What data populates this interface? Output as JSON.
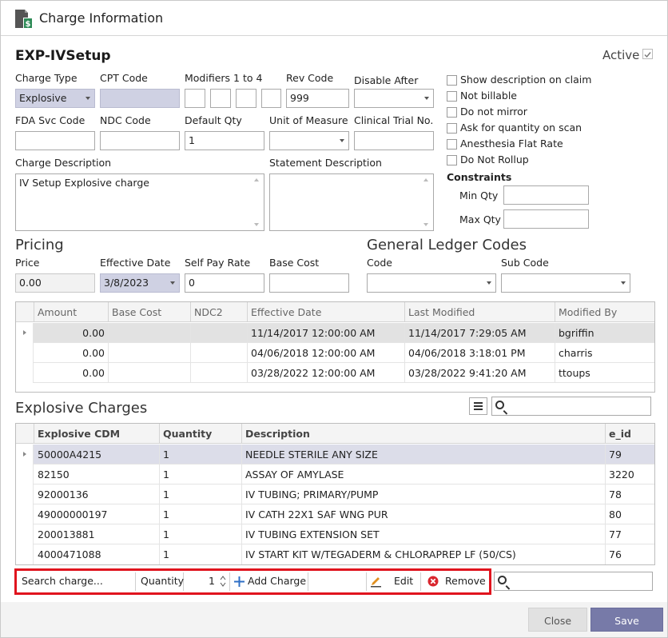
{
  "window": {
    "title": "Charge Information"
  },
  "heading": "EXP-IVSetup",
  "active": {
    "label": "Active",
    "checked": true
  },
  "fields": {
    "charge_type": {
      "label": "Charge Type",
      "value": "Explosive"
    },
    "cpt_code": {
      "label": "CPT Code",
      "value": ""
    },
    "modifiers": {
      "label": "Modifiers 1 to 4",
      "values": [
        "",
        "",
        "",
        ""
      ]
    },
    "rev_code": {
      "label": "Rev Code",
      "value": "999"
    },
    "disable_after": {
      "label": "Disable After",
      "value": ""
    },
    "fda_svc_code": {
      "label": "FDA Svc Code",
      "value": ""
    },
    "ndc_code": {
      "label": "NDC Code",
      "value": ""
    },
    "default_qty": {
      "label": "Default Qty",
      "value": "1"
    },
    "unit_of_measure": {
      "label": "Unit of Measure",
      "value": ""
    },
    "clinical_trial_no": {
      "label": "Clinical Trial No.",
      "value": ""
    },
    "charge_description": {
      "label": "Charge Description",
      "value": "IV Setup Explosive charge"
    },
    "statement_description": {
      "label": "Statement Description",
      "value": ""
    }
  },
  "options": [
    {
      "label": "Show description on claim",
      "checked": false
    },
    {
      "label": "Not billable",
      "checked": false
    },
    {
      "label": "Do not mirror",
      "checked": false
    },
    {
      "label": "Ask for quantity on scan",
      "checked": false
    },
    {
      "label": "Anesthesia Flat Rate",
      "checked": false
    },
    {
      "label": "Do Not Rollup",
      "checked": false
    }
  ],
  "constraints": {
    "title": "Constraints",
    "min_qty": {
      "label": "Min Qty",
      "value": ""
    },
    "max_qty": {
      "label": "Max Qty",
      "value": ""
    }
  },
  "pricing": {
    "title": "Pricing",
    "price": {
      "label": "Price",
      "value": "0.00"
    },
    "effective_date": {
      "label": "Effective Date",
      "value": "3/8/2023"
    },
    "self_pay_rate": {
      "label": "Self Pay Rate",
      "value": "0"
    },
    "base_cost": {
      "label": "Base Cost",
      "value": ""
    }
  },
  "gl": {
    "title": "General Ledger Codes",
    "code": {
      "label": "Code",
      "value": ""
    },
    "sub_code": {
      "label": "Sub Code",
      "value": ""
    }
  },
  "price_grid": {
    "columns": [
      "Amount",
      "Base Cost",
      "NDC2",
      "Effective Date",
      "Last Modified",
      "Modified By"
    ],
    "rows": [
      [
        "0.00",
        "",
        "",
        "11/14/2017 12:00:00 AM",
        "11/14/2017 7:29:05 AM",
        "bgriffin"
      ],
      [
        "0.00",
        "",
        "",
        "04/06/2018 12:00:00 AM",
        "04/06/2018 3:18:01 PM",
        "charris"
      ],
      [
        "0.00",
        "",
        "",
        "03/28/2022 12:00:00 AM",
        "03/28/2022 9:41:20 AM",
        "ttoups"
      ]
    ]
  },
  "explosive": {
    "title": "Explosive Charges",
    "search_value": "",
    "columns": [
      "Explosive CDM",
      "Quantity",
      "Description",
      "e_id"
    ],
    "rows": [
      [
        "50000A4215",
        "1",
        "NEEDLE STERILE ANY SIZE",
        "79"
      ],
      [
        "82150",
        "1",
        "ASSAY OF AMYLASE",
        "3220"
      ],
      [
        "92000136",
        "1",
        "IV TUBING; PRIMARY/PUMP",
        "78"
      ],
      [
        "49000000197",
        "1",
        "IV CATH 22X1 SAF WNG PUR",
        "80"
      ],
      [
        "200013881",
        "1",
        "IV TUBING EXTENSION SET",
        "77"
      ],
      [
        "4000471088",
        "1",
        "IV START KIT W/TEGADERM & CHLORAPREP LF (50/CS)",
        "76"
      ]
    ]
  },
  "toolbar": {
    "search_placeholder": "Search charge...",
    "quantity_label": "Quantity",
    "quantity_value": "1",
    "add_label": "Add Charge",
    "edit_label": "Edit",
    "remove_label": "Remove",
    "highlight_color": "#e0141e"
  },
  "footer": {
    "close_label": "Close",
    "save_label": "Save"
  },
  "colors": {
    "accent": "#777aa8",
    "selected_row": "#dcdde9"
  }
}
